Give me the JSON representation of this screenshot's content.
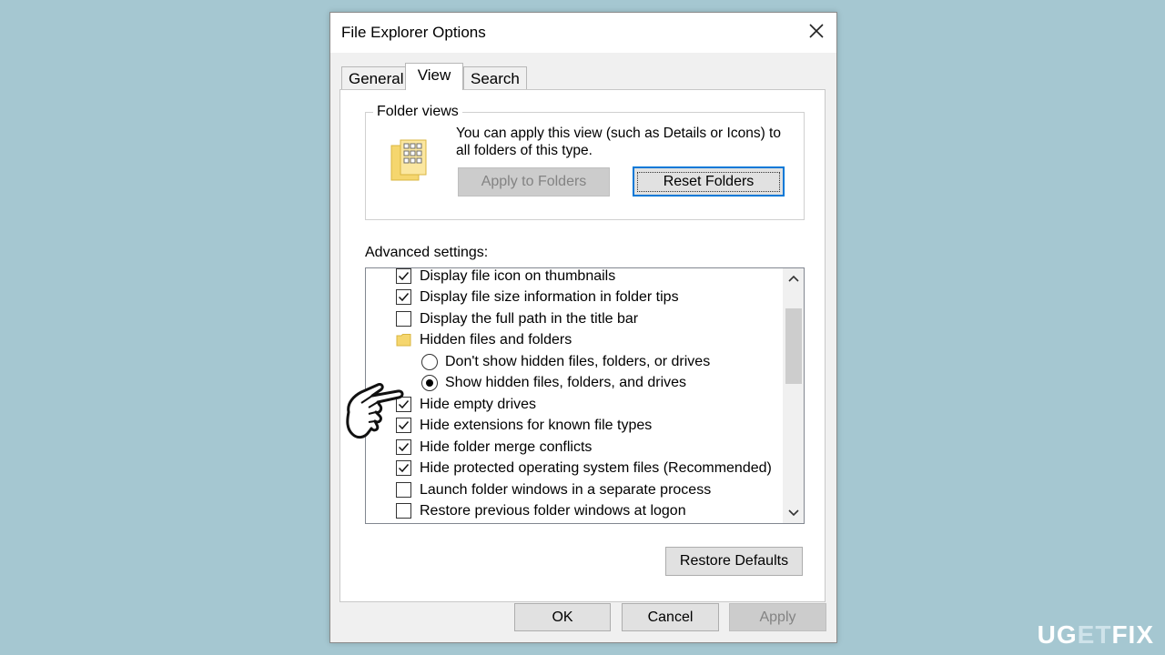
{
  "window": {
    "title": "File Explorer Options"
  },
  "tabs": [
    {
      "label": "General",
      "active": false
    },
    {
      "label": "View",
      "active": true
    },
    {
      "label": "Search",
      "active": false
    }
  ],
  "folder_views": {
    "label": "Folder views",
    "description": "You can apply this view (such as Details or Icons) to all folders of this type.",
    "apply_button": "Apply to Folders",
    "reset_button": "Reset Folders"
  },
  "advanced": {
    "label": "Advanced settings:",
    "items": [
      {
        "type": "checkbox",
        "checked": true,
        "label": "Display file icon on thumbnails"
      },
      {
        "type": "checkbox",
        "checked": true,
        "label": "Display file size information in folder tips"
      },
      {
        "type": "checkbox",
        "checked": false,
        "label": "Display the full path in the title bar"
      },
      {
        "type": "folder",
        "label": "Hidden files and folders"
      },
      {
        "type": "radio",
        "checked": false,
        "label": "Don't show hidden files, folders, or drives"
      },
      {
        "type": "radio",
        "checked": true,
        "label": "Show hidden files, folders, and drives"
      },
      {
        "type": "checkbox",
        "checked": true,
        "label": "Hide empty drives"
      },
      {
        "type": "checkbox",
        "checked": true,
        "label": "Hide extensions for known file types"
      },
      {
        "type": "checkbox",
        "checked": true,
        "label": "Hide folder merge conflicts"
      },
      {
        "type": "checkbox",
        "checked": true,
        "label": "Hide protected operating system files (Recommended)"
      },
      {
        "type": "checkbox",
        "checked": false,
        "label": "Launch folder windows in a separate process"
      },
      {
        "type": "checkbox",
        "checked": false,
        "label": "Restore previous folder windows at logon"
      }
    ],
    "restore_button": "Restore Defaults"
  },
  "footer": {
    "ok": "OK",
    "cancel": "Cancel",
    "apply": "Apply"
  },
  "watermark": {
    "part1": "UG",
    "part2": "ET",
    "part3": "FIX"
  },
  "colors": {
    "background": "#a5c7d1",
    "focus_blue": "#0078d7"
  }
}
